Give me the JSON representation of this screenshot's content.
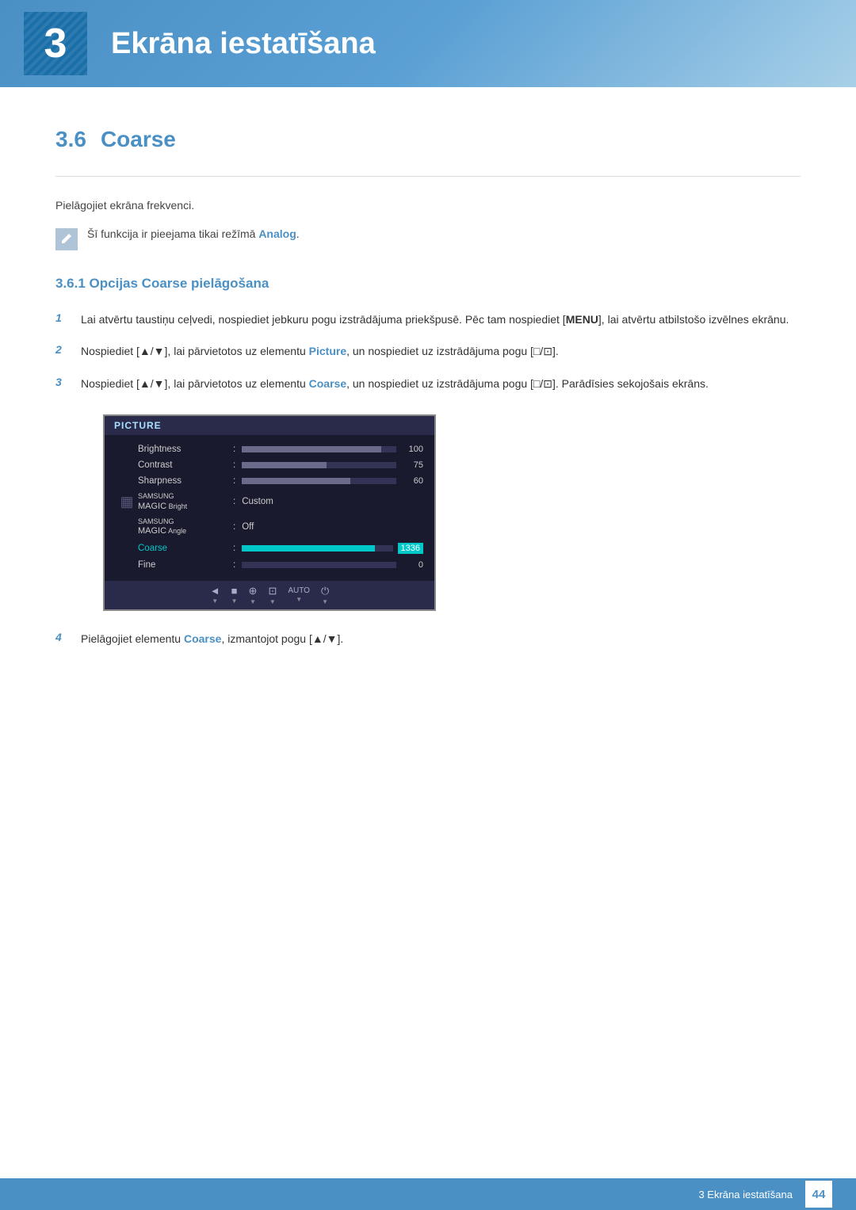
{
  "header": {
    "chapter_number": "3",
    "title": "Ekrāna iestatīšana"
  },
  "section": {
    "number": "3.6",
    "name": "Coarse",
    "description": "Pielāgojiet ekrāna frekvenci."
  },
  "note": {
    "text": "Šī funkcija ir pieejama tikai režīmā ",
    "highlight": "Analog",
    "suffix": "."
  },
  "subsection": {
    "title": "3.6.1   Opcijas Coarse pielāgošana"
  },
  "steps": [
    {
      "number": "1",
      "text": "Lai atvērtu taustiņu ceļvedi, nospiediet jebkuru pogu izstrādājuma priekšpusē. Pēc tam nospiediet [",
      "bold_part": "MENU",
      "text2": "], lai atvērtu atbilstošo izvēlnes ekrānu."
    },
    {
      "number": "2",
      "text": "Nospiediet [▲/▼], lai pārvietotos uz elementu ",
      "bold_part": "Picture",
      "text2": ", un nospiediet uz izstrādājuma pogu [□/⊡]."
    },
    {
      "number": "3",
      "text": "Nospiediet [▲/▼], lai pārvietotos uz elementu ",
      "bold_part": "Coarse",
      "text2": ", un nospiediet uz izstrādājuma pogu [□/⊡]. Parādīsies sekojošais ekrāns."
    },
    {
      "number": "4",
      "text": "Pielāgojiet elementu ",
      "bold_part": "Coarse",
      "text2": ", izmantojot pogu [▲/▼]."
    }
  ],
  "monitor": {
    "title": "PICTURE",
    "rows": [
      {
        "label": "Brightness",
        "type": "bar",
        "fill": "full",
        "value": "100"
      },
      {
        "label": "Contrast",
        "type": "bar",
        "fill": "medium",
        "value": "75"
      },
      {
        "label": "Sharpness",
        "type": "bar",
        "fill": "short",
        "value": "60"
      },
      {
        "label": "SAMSUNG\nMAGIC Bright",
        "type": "text",
        "value": "Custom"
      },
      {
        "label": "SAMSUNG\nMAGIC Angle",
        "type": "text",
        "value": "Off"
      },
      {
        "label": "Coarse",
        "type": "bar",
        "fill": "coarse",
        "value": "1336",
        "highlighted": true
      },
      {
        "label": "Fine",
        "type": "bar",
        "fill": "fine-empty",
        "value": "0"
      }
    ],
    "icons": [
      "◄",
      "■",
      "⊕",
      "⊡",
      "AUTO",
      "⏻"
    ]
  },
  "footer": {
    "chapter_label": "3 Ekrāna iestatīšana",
    "page": "44"
  }
}
